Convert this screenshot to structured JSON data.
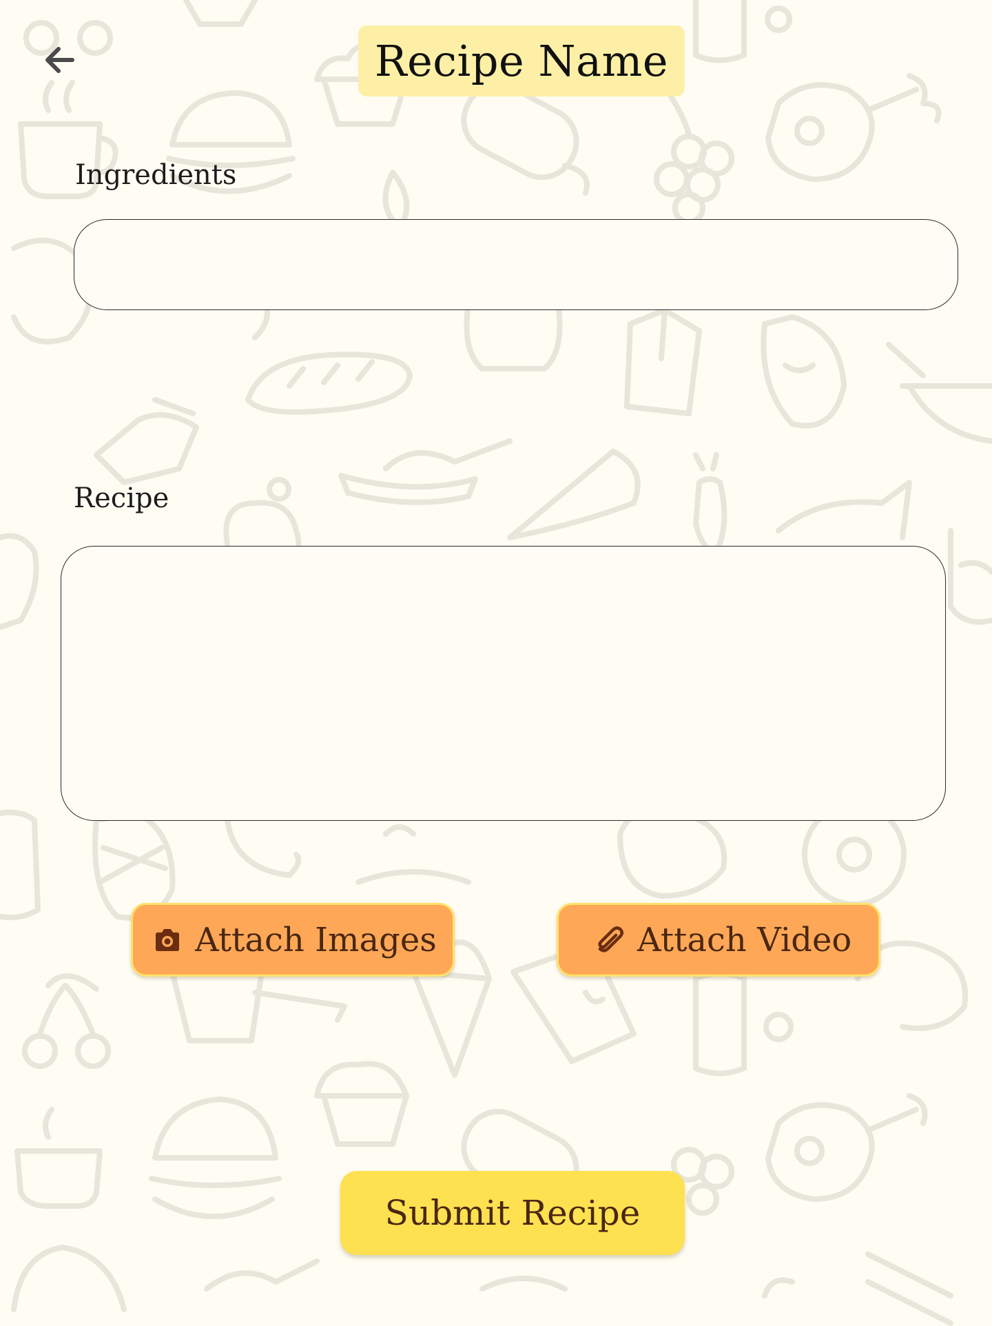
{
  "header": {
    "back_icon": "arrow-left-icon",
    "title": "Recipe Name"
  },
  "form": {
    "ingredients_label": "Ingredients",
    "ingredients_value": "",
    "recipe_label": "Recipe",
    "recipe_value": ""
  },
  "attachments": {
    "images_label": "Attach Images",
    "images_icon": "camera-icon",
    "video_label": "Attach Video",
    "video_icon": "paperclip-icon"
  },
  "actions": {
    "submit_label": "Submit Recipe"
  },
  "colors": {
    "background": "#fefcf3",
    "title_highlight": "#fdf0a6",
    "attach_button": "#fea857",
    "attach_border": "#fde36b",
    "submit_button": "#fde151",
    "button_text": "#4a2712"
  }
}
